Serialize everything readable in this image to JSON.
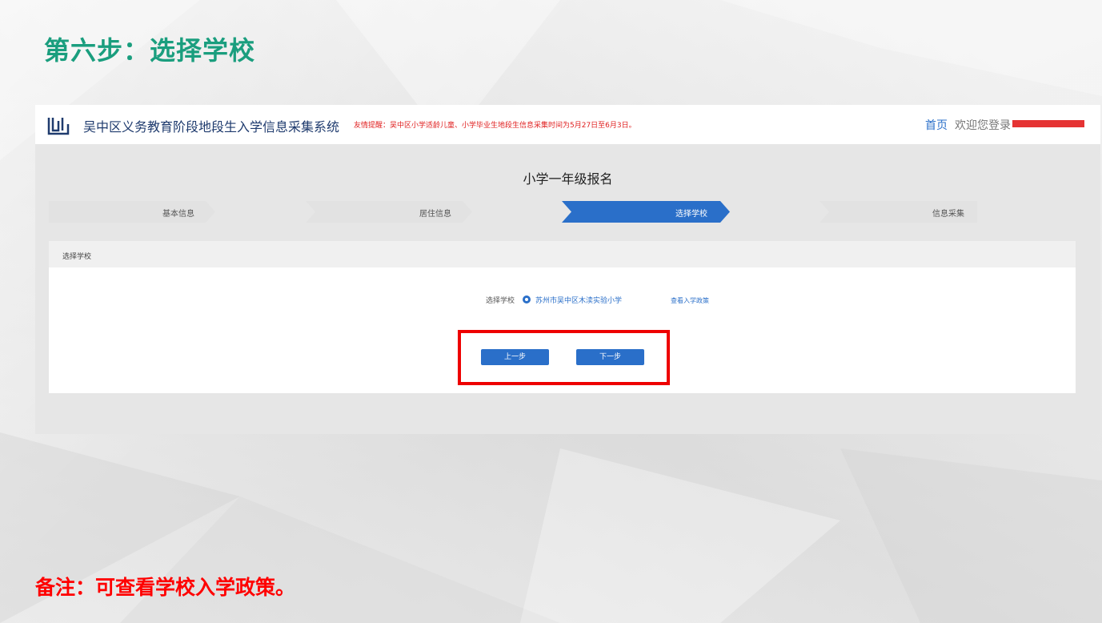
{
  "slide": {
    "title": "第六步：选择学校",
    "note": "备注：可查看学校入学政策。"
  },
  "header": {
    "logo_icon": "book-logo-icon",
    "app_title": "吴中区义务教育阶段地段生入学信息采集系统",
    "reminder": "友情提醒：吴中区小学适龄儿童、小学毕业生地段生信息采集时间为5月27日至6月3日。",
    "home_link": "首页",
    "welcome": "欢迎您登录"
  },
  "page": {
    "heading": "小学一年级报名"
  },
  "steps": [
    {
      "label": "基本信息",
      "active": false
    },
    {
      "label": "居住信息",
      "active": false
    },
    {
      "label": "选择学校",
      "active": true
    },
    {
      "label": "信息采集",
      "active": false
    }
  ],
  "panel": {
    "title": "选择学校",
    "field_label": "选择学校",
    "selected_school": "苏州市吴中区木渎实验小学",
    "policy_link": "查看入学政策",
    "prev_button": "上一步",
    "next_button": "下一步"
  },
  "colors": {
    "accent": "#2a6fc9",
    "title_green": "#1a9e7e",
    "alert_red": "#ff0000",
    "step_inactive": "#e2e2e2"
  }
}
